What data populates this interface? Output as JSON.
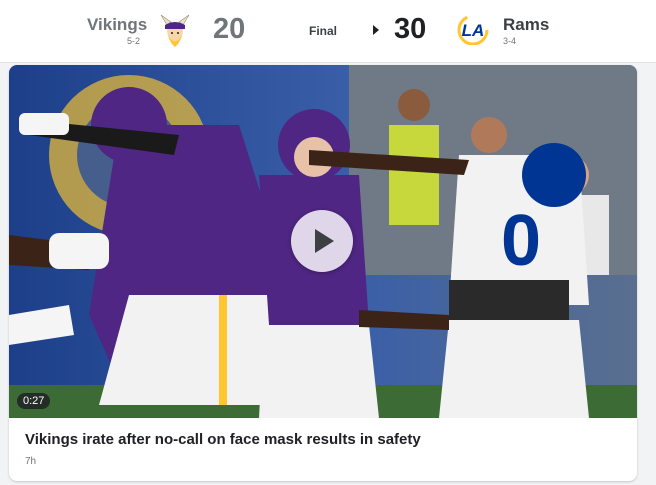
{
  "scoreboard": {
    "status": "Final",
    "home": {
      "name": "Vikings",
      "record": "5-2",
      "score": "20",
      "logo": "vikings-logo"
    },
    "away": {
      "name": "Rams",
      "record": "3-4",
      "score": "30",
      "logo": "rams-logo"
    },
    "colors": {
      "loser_score": "#70757a",
      "winner_score": "#202124"
    }
  },
  "video": {
    "duration": "0:27",
    "headline": "Vikings irate after no-call on face mask results in safety",
    "time_ago": "7h",
    "icon": "play-icon"
  }
}
